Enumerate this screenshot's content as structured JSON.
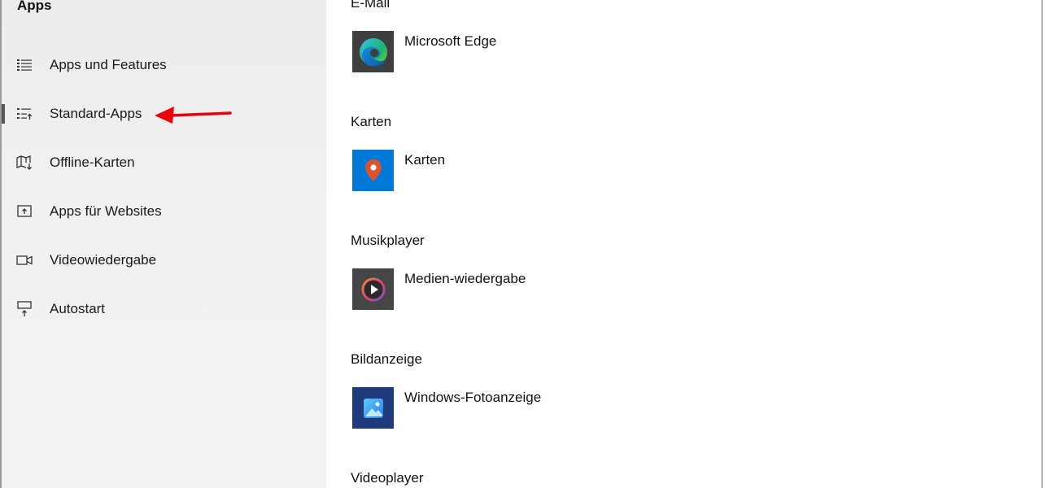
{
  "sidebar": {
    "heading": "Apps",
    "items": [
      {
        "label": "Apps und Features",
        "icon": "list-icon"
      },
      {
        "label": "Standard-Apps",
        "icon": "default-apps-icon",
        "selected": true
      },
      {
        "label": "Offline-Karten",
        "icon": "offline-map-icon"
      },
      {
        "label": "Apps für Websites",
        "icon": "web-app-icon"
      },
      {
        "label": "Videowiedergabe",
        "icon": "video-icon"
      },
      {
        "label": "Autostart",
        "icon": "startup-icon"
      }
    ]
  },
  "annotation": {
    "arrow_color": "#e8000b"
  },
  "content": {
    "sections": [
      {
        "title": "E-Mail",
        "app": "Microsoft Edge",
        "icon": "edge-icon"
      },
      {
        "title": "Karten",
        "app": "Karten",
        "icon": "maps-icon"
      },
      {
        "title": "Musikplayer",
        "app": "Medien-wiedergabe",
        "icon": "media-player-icon"
      },
      {
        "title": "Bildanzeige",
        "app": "Windows-Fotoanzeige",
        "icon": "photo-viewer-icon"
      },
      {
        "title": "Videoplayer"
      }
    ]
  },
  "colors": {
    "selected_indicator": "#555555",
    "maps_tile": "#0078d7",
    "media_tile": "#464646",
    "photo_tile": "#1e3a7a"
  }
}
